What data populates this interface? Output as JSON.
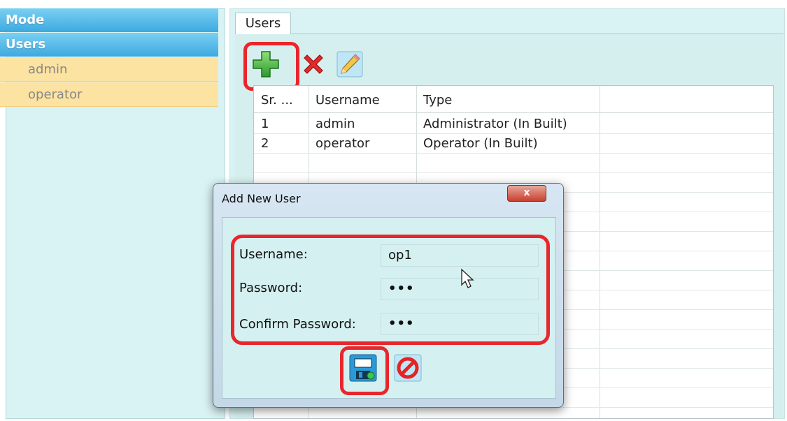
{
  "nav": {
    "mode_label": "Mode",
    "users_label": "Users",
    "user_items": [
      "admin",
      "operator"
    ]
  },
  "tabs": {
    "users_label": "Users"
  },
  "toolbar": {
    "icons": [
      "add-icon",
      "delete-icon",
      "edit-icon"
    ]
  },
  "table": {
    "headers": [
      "Sr. ...",
      "Username",
      "Type"
    ],
    "rows": [
      [
        "1",
        "admin",
        "Administrator (In Built)"
      ],
      [
        "2",
        "operator",
        "Operator (In Built)"
      ]
    ]
  },
  "dialog": {
    "title": "Add New User",
    "close_label": "x",
    "fields": {
      "username_label": "Username:",
      "username_value": "op1",
      "password_label": "Password:",
      "password_value": "•••",
      "confirm_label": "Confirm Password:",
      "confirm_value": "•••"
    },
    "icons": [
      "save-icon",
      "cancel-icon"
    ]
  },
  "colors": {
    "highlight": "#e8262c",
    "nav_header": "#3da9e0",
    "nav_item": "#fde3a1",
    "panel_bg": "#d9f2f3"
  }
}
